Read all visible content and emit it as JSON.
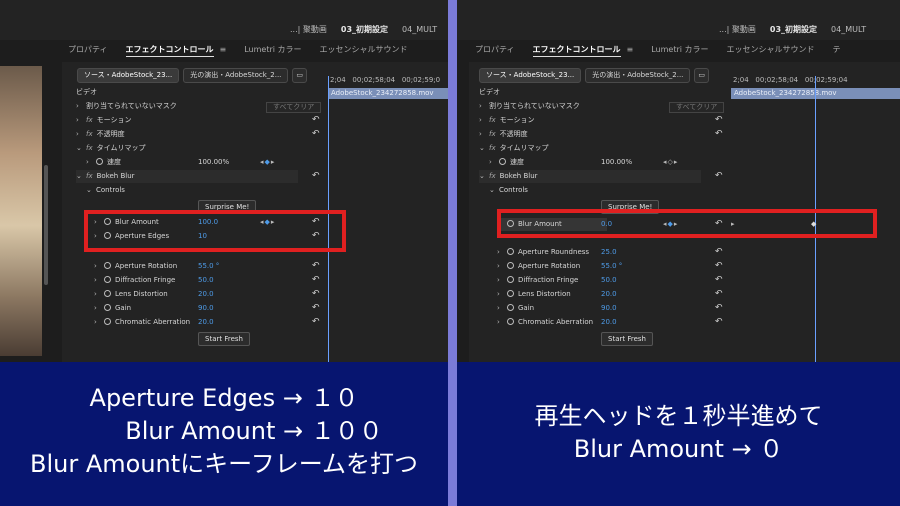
{
  "left": {
    "sequence_tabs": [
      "...| 聚動画",
      "03_初期設定",
      "04_MULT"
    ],
    "panel_tabs": [
      "プロパティ",
      "エフェクトコントロール",
      "≡",
      "Lumetri カラー",
      "エッセンシャルサウンド"
    ],
    "source_tabs": [
      "ソース・AdobeStock_23...",
      "光の演出・AdobeStock_2..."
    ],
    "timecodes": [
      "2;04",
      "00;02;58;04",
      "00;02;59;0"
    ],
    "clip_name": "AdobeStock_234272858.mov",
    "section_label": "ビデオ",
    "mask_label": "割り当てられていないマスク",
    "clear_all": "すべてクリア",
    "motion": "モーション",
    "opacity": "不透明度",
    "time_remap": "タイムリマップ",
    "speed_label": "速度",
    "speed_value": "100.00%",
    "effect_name": "Bokeh Blur",
    "controls_label": "Controls",
    "surprise_btn": "Surprise Me!",
    "params": [
      {
        "label": "Blur Amount",
        "value": "100.0"
      },
      {
        "label": "Aperture Edges",
        "value": "10"
      },
      {
        "label": "Aperture Rotation",
        "value": "55.0 °"
      },
      {
        "label": "Diffraction Fringe",
        "value": "50.0"
      },
      {
        "label": "Lens Distortion",
        "value": "20.0"
      },
      {
        "label": "Gain",
        "value": "90.0"
      },
      {
        "label": "Chromatic Aberration",
        "value": "20.0"
      }
    ],
    "start_fresh": "Start Fresh",
    "caption": [
      "Aperture Edges → １０",
      "Blur Amount → １００",
      "Blur Amountにキーフレームを打つ"
    ]
  },
  "right": {
    "sequence_tabs": [
      "...| 聚動画",
      "03_初期設定",
      "04_MULT"
    ],
    "panel_tabs": [
      "プロパティ",
      "エフェクトコントロール",
      "≡",
      "Lumetri カラー",
      "エッセンシャルサウンド",
      "テ"
    ],
    "source_tabs": [
      "ソース・AdobeStock_23...",
      "光の演出・AdobeStock_2..."
    ],
    "timecodes": [
      "2;04",
      "00;02;58;04",
      "00;02;59;04"
    ],
    "clip_name": "AdobeStock_234272858.mov",
    "section_label": "ビデオ",
    "mask_label": "割り当てられていないマスク",
    "clear_all": "すべてクリア",
    "motion": "モーション",
    "opacity": "不透明度",
    "time_remap": "タイムリマップ",
    "speed_label": "速度",
    "speed_value": "100.00%",
    "effect_name": "Bokeh Blur",
    "controls_label": "Controls",
    "surprise_btn": "Surprise Me!",
    "params": [
      {
        "label": "Blur Amount",
        "value": "0.0"
      },
      {
        "label": "Aperture Roundness",
        "value": "25.0"
      },
      {
        "label": "Aperture Rotation",
        "value": "55.0 °"
      },
      {
        "label": "Diffraction Fringe",
        "value": "50.0"
      },
      {
        "label": "Lens Distortion",
        "value": "20.0"
      },
      {
        "label": "Gain",
        "value": "90.0"
      },
      {
        "label": "Chromatic Aberration",
        "value": "20.0"
      }
    ],
    "start_fresh": "Start Fresh",
    "caption": [
      "再生ヘッドを１秒半進めて",
      "Blur Amount →  ０"
    ]
  },
  "colors": {
    "highlight_box": "#e02020",
    "caption_bg": "#071570",
    "divider": "#7b7bd8",
    "value_blue": "#4e9be8"
  },
  "icons": [
    "reset-icon",
    "stopwatch-icon",
    "keyframe-diamond-icon",
    "panel-menu-icon",
    "playhead-icon"
  ]
}
